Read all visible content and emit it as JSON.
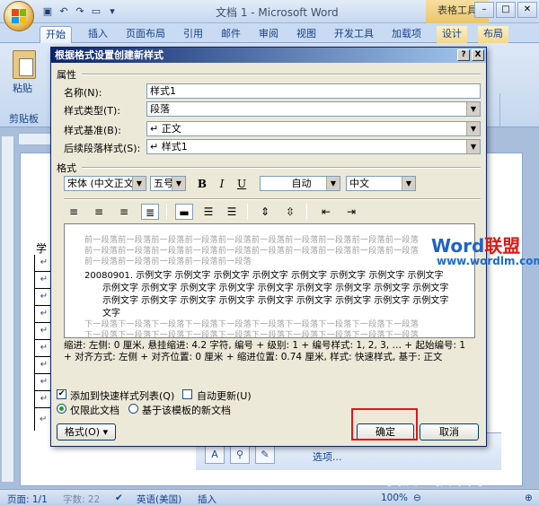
{
  "window": {
    "title": "文档 1 - Microsoft Word",
    "context_tab_group": "表格工具"
  },
  "ribbon_tabs": [
    "开始",
    "插入",
    "页面布局",
    "引用",
    "邮件",
    "审阅",
    "视图",
    "开发工具",
    "加载项",
    "设计",
    "布局"
  ],
  "ribbon": {
    "paste_label": "粘贴",
    "clipboard_group": "剪贴板"
  },
  "document": {
    "table_header_char": "学",
    "paragraph_mark": "↵"
  },
  "styles_pane": {
    "options_link": "选项..."
  },
  "watermark": {
    "brand_word": "Word",
    "brand_cn": "联盟",
    "url": "www.wordlm.com",
    "bottom_text": "我爱IT技术网"
  },
  "status_bar": {
    "page": "页面: 1/1",
    "word_count": "字数: 22",
    "language": "英语(美国)",
    "insert_mode": "插入",
    "zoom": "100%"
  },
  "dialog": {
    "title": "根据格式设置创建新样式",
    "help_button": "?",
    "close_button": "X",
    "properties_group": "属性",
    "name_label": "名称(N):",
    "name_value": "样式1",
    "style_type_label": "样式类型(T):",
    "style_type_value": "段落",
    "based_on_label": "样式基准(B):",
    "based_on_value": "↵ 正文",
    "following_label": "后续段落样式(S):",
    "following_value": "↵ 样式1",
    "format_group": "格式",
    "font_value": "宋体 (中文正文",
    "size_value": "五号",
    "bold": "B",
    "italic": "I",
    "underline": "U",
    "color_value": "自动",
    "language_value": "中文",
    "preview": {
      "prev_para_1": "前一段落前一段落前一段落前一段落前一段落前一段落前一段落前一段落前一段落前一段落",
      "prev_para_2": "前一段落前一段落前一段落前一段落前一段落前一段落前一段落前一段落前一段落前一段落",
      "prev_para_3": "前一段落前一段落前一段落前一段落前一段落",
      "sample_line_1": "20080901.    示例文字 示例文字 示例文字 示例文字 示例文字 示例文字 示例文字 示例文字",
      "sample_line_2": "示例文字 示例文字 示例文字 示例文字 示例文字 示例文字 示例文字 示例文字 示例文字",
      "sample_line_3": "示例文字 示例文字 示例文字 示例文字 示例文字 示例文字 示例文字 示例文字 示例文字",
      "sample_line_4": "文字",
      "next_para_1": "下一段落下一段落下一段落下一段落下一段落下一段落下一段落下一段落下一段落下一段落",
      "next_para_2": "下一段落下一段落下一段落下一段落下一段落下一段落下一段落下一段落下一段落下一段落"
    },
    "description": "缩进: 左侧: 0 厘米, 悬挂缩进: 4.2 字符, 编号 + 级别: 1 + 编号样式: 1, 2, 3, … + 起始编号: 1 + 对齐方式: 左侧 + 对齐位置: 0 厘米 + 缩进位置: 0.74 厘米, 样式: 快速样式, 基于: 正文",
    "add_to_quick_list": "添加到快速样式列表(Q)",
    "auto_update": "自动更新(U)",
    "only_this_doc": "仅限此文档",
    "new_docs_template": "基于该模板的新文档",
    "format_button": "格式(O) ▾",
    "ok_button": "确定",
    "cancel_button": "取消"
  }
}
